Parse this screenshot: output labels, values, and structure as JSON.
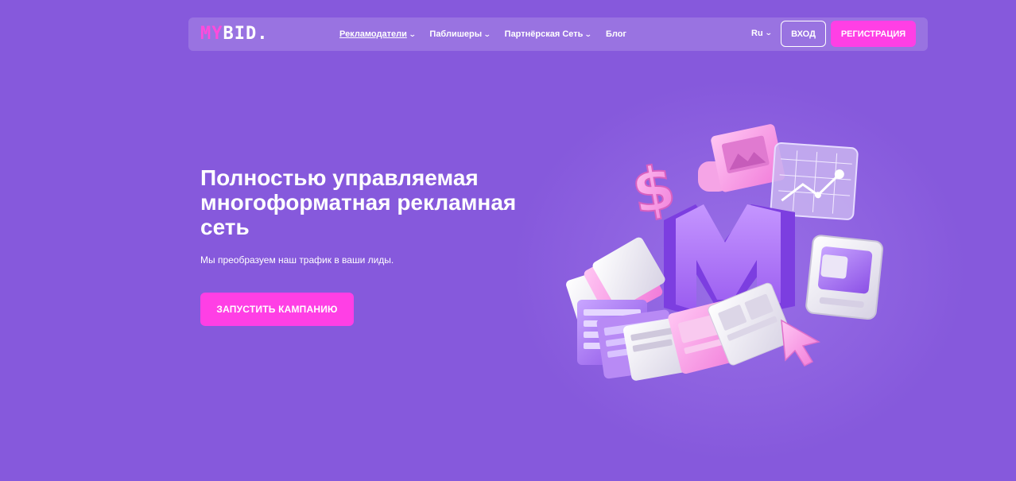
{
  "header": {
    "logo_part1": "MY",
    "logo_part2": "BID.",
    "nav": [
      {
        "label": "Рекламодатели",
        "active": true
      },
      {
        "label": "Паблишеры",
        "active": false
      },
      {
        "label": "Партнёрская Сеть",
        "active": false
      },
      {
        "label": "Блог",
        "active": false
      }
    ],
    "lang": "Ru",
    "login_label": "ВХОД",
    "register_label": "РЕГИСТРАЦИЯ"
  },
  "hero": {
    "title": "Полностью управляемая многоформатная рекламная сеть",
    "subtitle": "Мы преобразуем наш трафик в ваши лиды.",
    "cta_label": "ЗАПУСТИТЬ КАМПАНИЮ"
  },
  "colors": {
    "background": "#8659dc",
    "accent": "#ff3fe5",
    "text": "#ffffff"
  },
  "icons": {
    "chevron": "chevron-down-icon",
    "illustration": "3d-ad-formats-illustration"
  }
}
